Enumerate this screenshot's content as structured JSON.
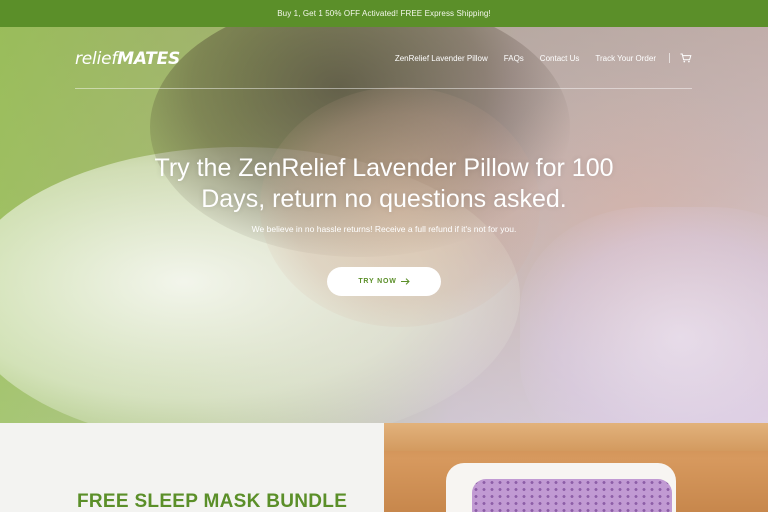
{
  "promo": {
    "text": "Buy 1, Get 1 50% OFF Activated! FREE Express Shipping!"
  },
  "header": {
    "logo_part1": "relief",
    "logo_part2": "MATES",
    "nav": [
      {
        "label": "ZenRelief Lavender Pillow"
      },
      {
        "label": "FAQs"
      },
      {
        "label": "Contact Us"
      },
      {
        "label": "Track Your Order"
      }
    ],
    "cart_icon": "cart-icon"
  },
  "hero": {
    "title_line1": "Try the ZenRelief Lavender Pillow for 100",
    "title_line2": "Days, return no questions asked.",
    "subtitle": "We believe in no hassle returns! Receive a full refund if it's not for you.",
    "cta_label": "TRY NOW",
    "cta_icon": "arrow-right-icon"
  },
  "section": {
    "title": "FREE SLEEP MASK BUNDLE"
  },
  "colors": {
    "brand_green": "#5b8f29",
    "white": "#ffffff"
  }
}
